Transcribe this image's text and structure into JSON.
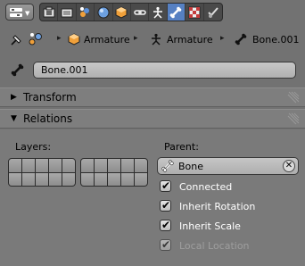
{
  "header": {
    "editor_type_icon": "editor-type-icon",
    "tabs": [
      {
        "name": "render-layers-icon",
        "active": false
      },
      {
        "name": "scene-icon",
        "active": false
      },
      {
        "name": "world-icon",
        "active": false
      },
      {
        "name": "object-icon",
        "active": false
      },
      {
        "name": "constraints-icon",
        "active": false
      },
      {
        "name": "object-data-armature-icon",
        "active": false
      },
      {
        "name": "bone-icon",
        "active": true
      },
      {
        "name": "texture-icon",
        "active": false
      },
      {
        "name": "bone-constraint-icon",
        "active": false
      }
    ]
  },
  "breadcrumb": {
    "pin_icon": "pin-icon",
    "context_icon": "context-icon",
    "items": [
      {
        "label": "Armature",
        "icon": "object-icon"
      },
      {
        "label": "Armature",
        "icon": "armature-icon"
      },
      {
        "label": "Bone.001",
        "icon": "bone-icon"
      }
    ],
    "separator": "▸"
  },
  "bone_name": {
    "value": "Bone.001",
    "icon": "bone-icon"
  },
  "panels": {
    "transform": {
      "label": "Transform",
      "expanded": false
    },
    "relations": {
      "label": "Relations",
      "expanded": true
    }
  },
  "relations": {
    "layers_label": "Layers:",
    "parent_label": "Parent:",
    "parent_value": "Bone",
    "clear_symbol": "✕",
    "options": [
      {
        "label": "Connected",
        "checked": true,
        "enabled": true
      },
      {
        "label": "Inherit Rotation",
        "checked": true,
        "enabled": true
      },
      {
        "label": "Inherit Scale",
        "checked": true,
        "enabled": true
      },
      {
        "label": "Local Location",
        "checked": true,
        "enabled": false
      }
    ]
  },
  "colors": {
    "background": "#727272",
    "active_tab": "#5680c2",
    "checkbox_label": "#ffffff",
    "disabled_label": "#9e9e9e"
  }
}
